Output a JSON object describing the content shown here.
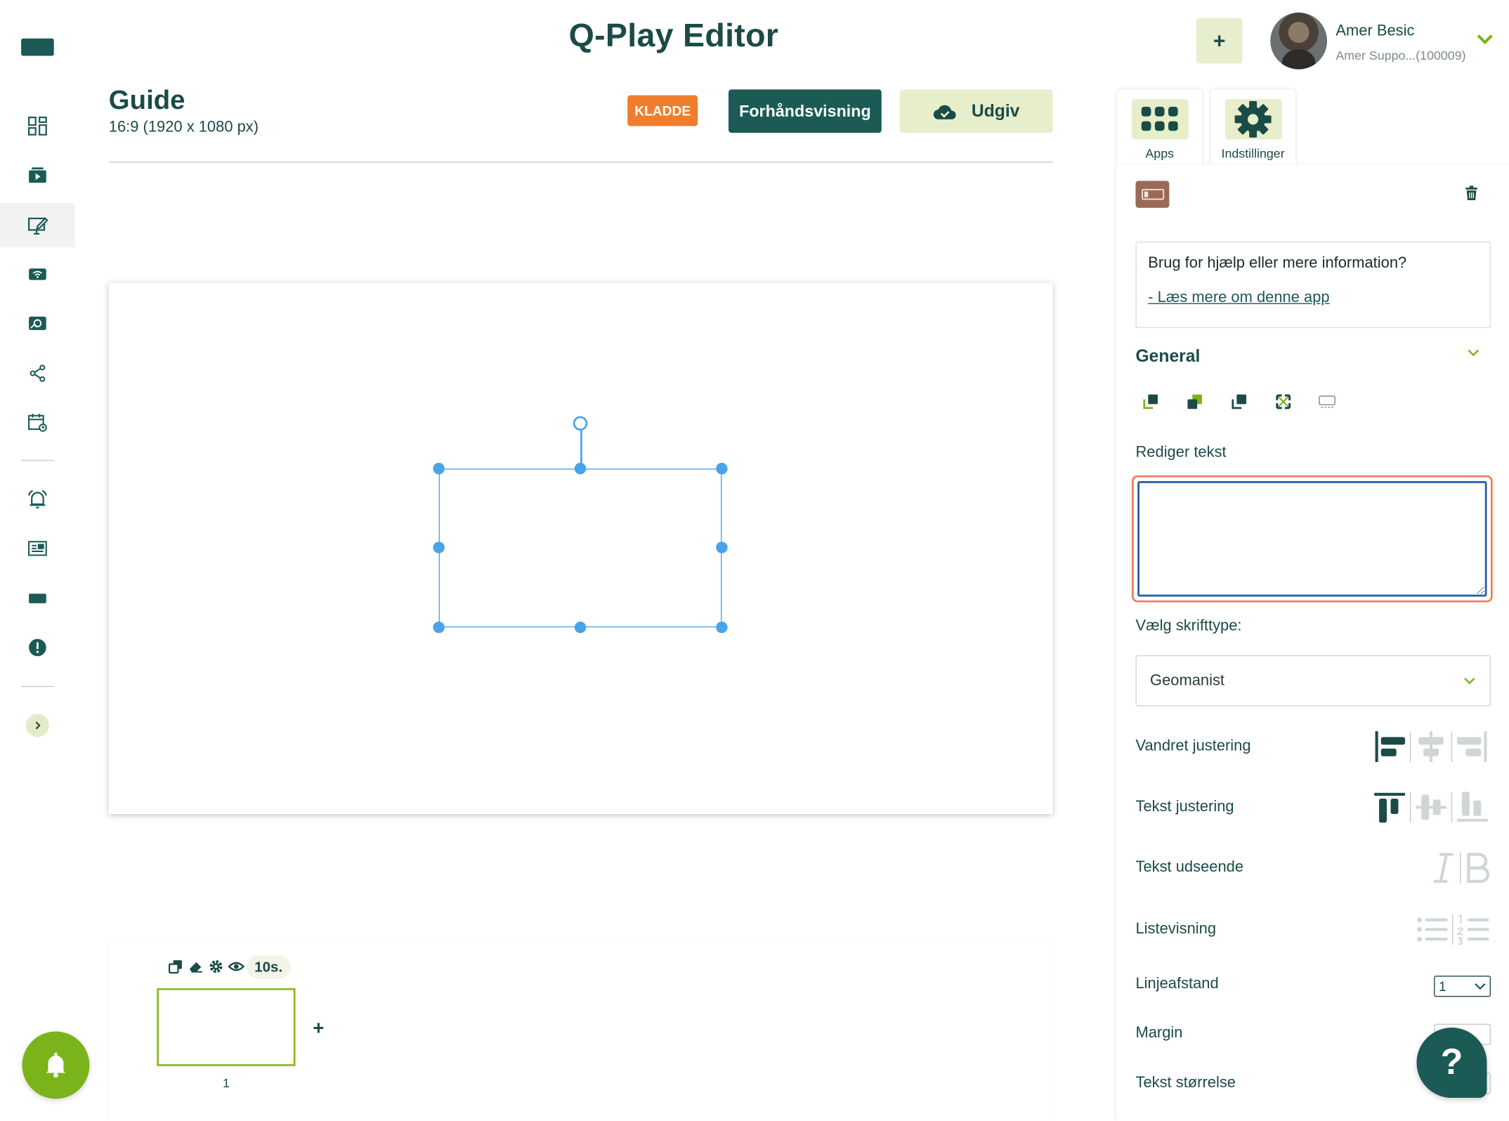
{
  "header": {
    "title": "Q-Play Editor",
    "add_button": "+",
    "user": {
      "name": "Amer Besic",
      "subtitle": "Amer Suppo...(100009)"
    }
  },
  "guide": {
    "title": "Guide",
    "resolution": "16:9 (1920 x 1080 px)",
    "status_badge": "KLADDE",
    "preview_label": "Forhåndsvisning",
    "publish_label": "Udgiv"
  },
  "sidebar": {
    "items": [
      {
        "icon": "dashboard-icon"
      },
      {
        "icon": "media-icon"
      },
      {
        "icon": "editor-icon",
        "active": true
      },
      {
        "icon": "wifi-screen-icon"
      },
      {
        "icon": "gallery-icon"
      },
      {
        "icon": "share-icon"
      },
      {
        "icon": "schedule-icon"
      },
      {
        "icon": "alarm-icon"
      },
      {
        "icon": "news-icon"
      },
      {
        "icon": "screen-icon"
      },
      {
        "icon": "alert-icon"
      }
    ]
  },
  "timeline": {
    "duration": "10s.",
    "slides": [
      {
        "number": "1"
      }
    ],
    "add_slide": "+"
  },
  "panel": {
    "tabs": [
      {
        "label": "Apps",
        "icon": "apps-grid-icon"
      },
      {
        "label": "Indstillinger",
        "icon": "gear-icon"
      }
    ],
    "help_question": "Brug for hjælp eller mere information?",
    "help_link": "- Læs mere om denne app",
    "section_title": "General",
    "edit_text_label": "Rediger tekst",
    "edit_text_value": "",
    "font_label": "Vælg skrifttype:",
    "font_value": "Geomanist",
    "h_align_label": "Vandret justering",
    "v_align_label": "Tekst justering",
    "appearance_label": "Tekst udseende",
    "list_label": "Listevisning",
    "line_spacing_label": "Linjeafstand",
    "line_spacing_value": "1",
    "margin_label": "Margin",
    "text_size_label": "Tekst størrelse"
  },
  "help_fab": "?",
  "colors": {
    "primary": "#1b5a55",
    "accent_green": "#7bb31a",
    "light_green": "#e6eecb",
    "draft_orange": "#ee7e2d",
    "selection_blue": "#4aa3ea"
  }
}
